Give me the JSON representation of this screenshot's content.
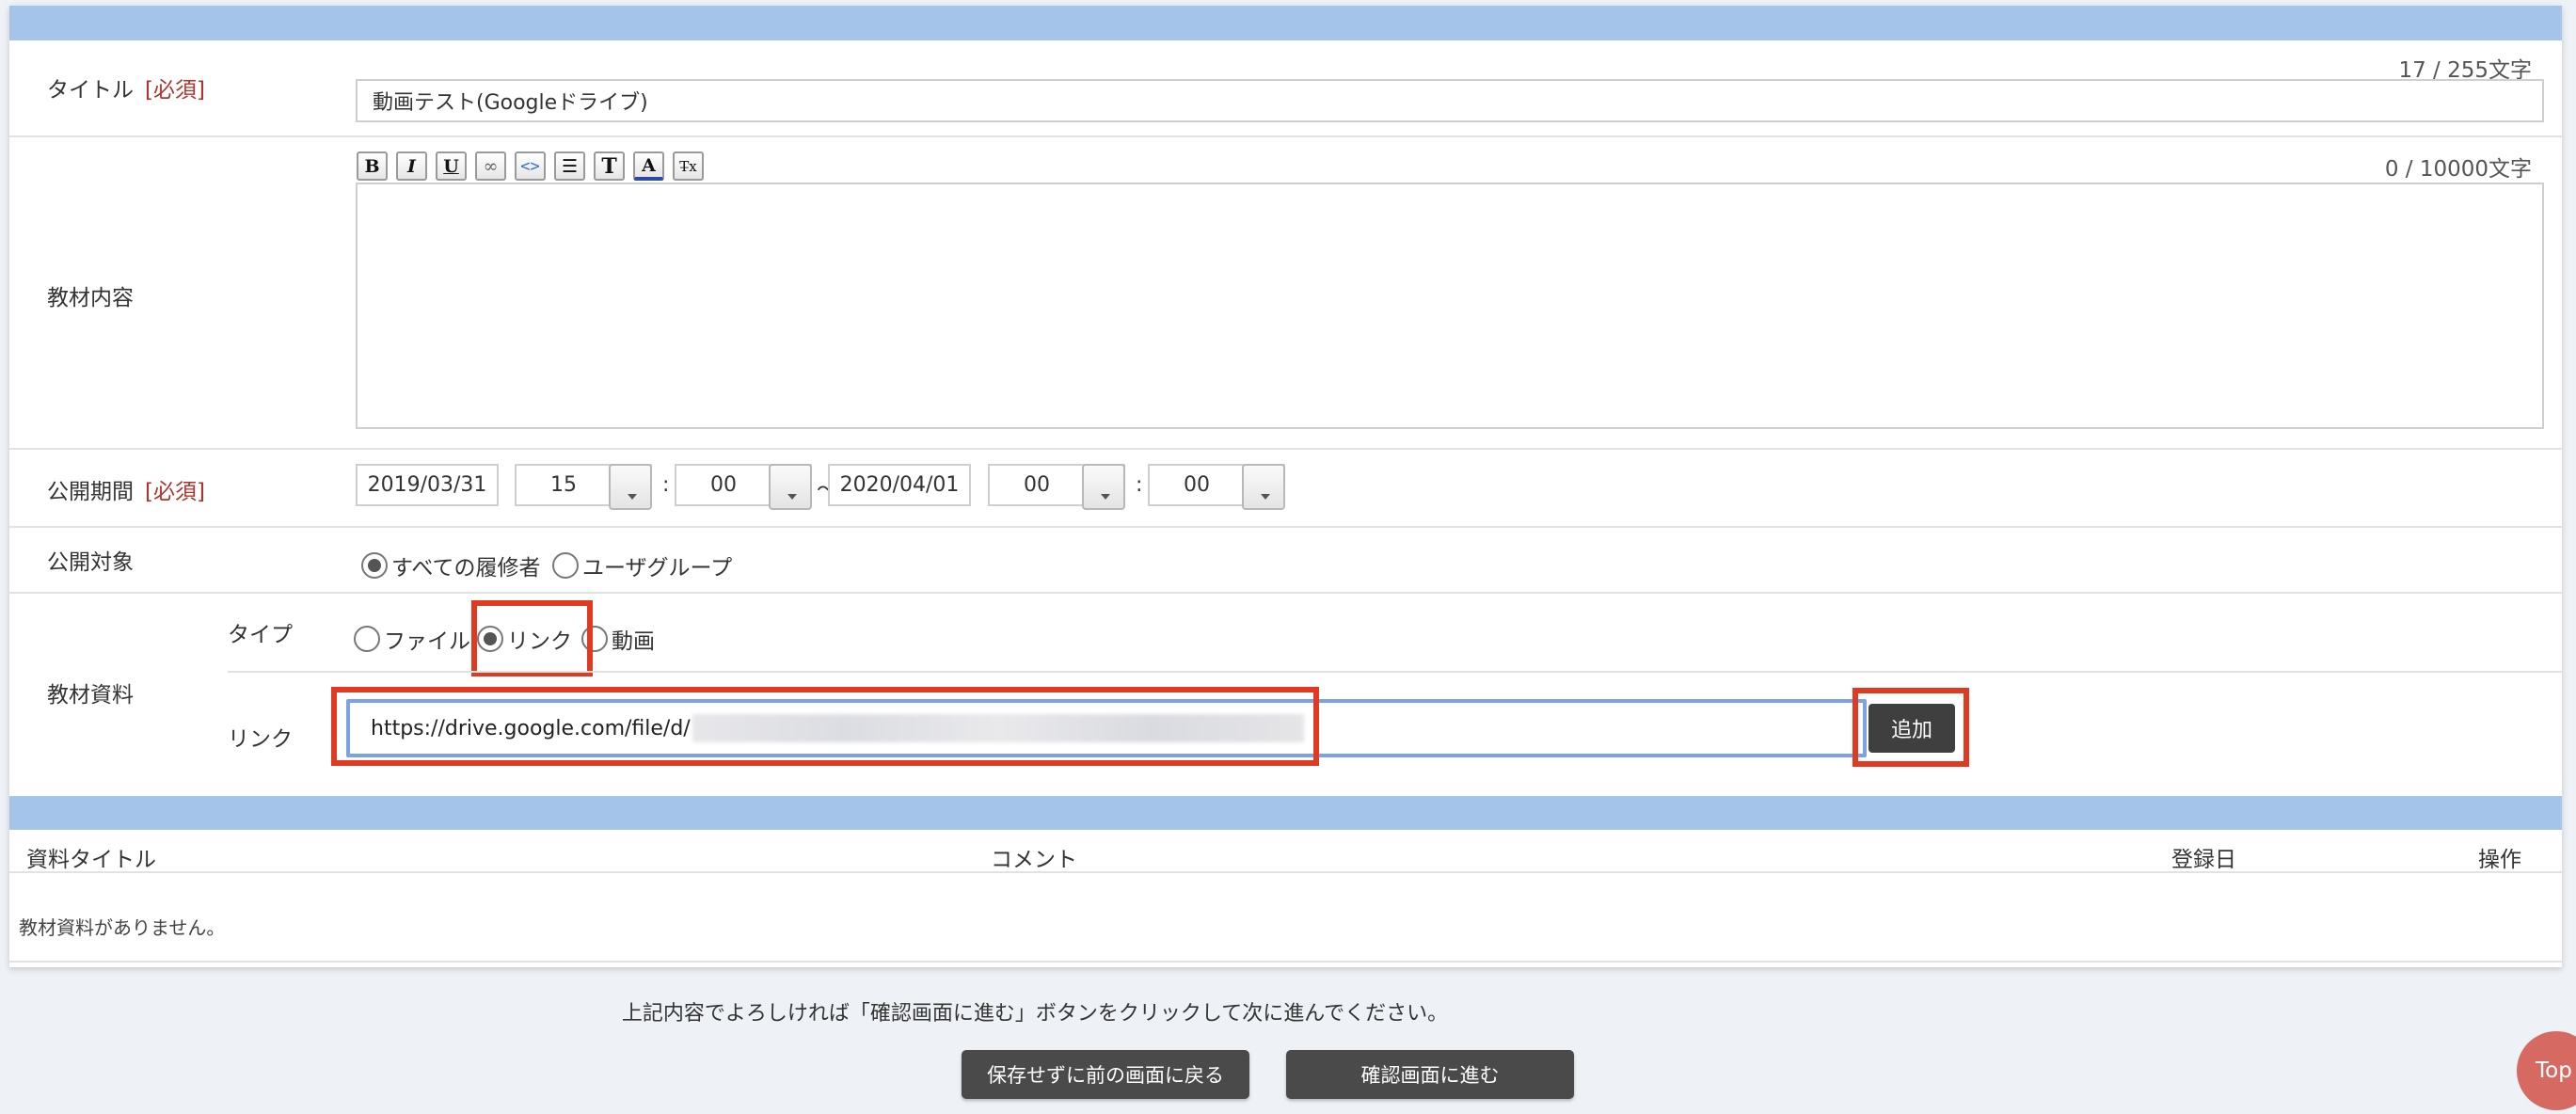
{
  "form": {
    "title": {
      "label": "タイトル",
      "required": "[必須]",
      "counter": "17 / 255文字",
      "value": "動画テスト(Googleドライブ)"
    },
    "content": {
      "label": "教材内容",
      "counter": "0 / 10000文字",
      "toolbar": [
        {
          "icon": "bold-icon",
          "glyph": "B"
        },
        {
          "icon": "italic-icon",
          "glyph": "I"
        },
        {
          "icon": "underline-icon",
          "glyph": "U"
        },
        {
          "icon": "link-icon",
          "glyph": "∞"
        },
        {
          "icon": "code-icon",
          "glyph": "<>"
        },
        {
          "icon": "bullet-list-icon",
          "glyph": "☰"
        },
        {
          "icon": "font-size-icon",
          "glyph": "T"
        },
        {
          "icon": "font-color-icon",
          "glyph": "A"
        },
        {
          "icon": "clear-format-icon",
          "glyph": "T̶x"
        }
      ]
    },
    "period": {
      "label": "公開期間",
      "required": "[必須]",
      "start_date": "2019/03/31",
      "start_hour": "15",
      "start_minute": "00",
      "tilde": "〜",
      "end_date": "2020/04/01",
      "end_hour": "00",
      "end_minute": "00",
      "colon": ":"
    },
    "audience": {
      "label": "公開対象",
      "options": [
        "すべての履修者",
        "ユーザグループ"
      ],
      "selected": "すべての履修者"
    },
    "material": {
      "label": "教材資料",
      "type_label": "タイプ",
      "type_options": [
        "ファイル",
        "リンク",
        "動画"
      ],
      "type_selected": "リンク",
      "link_label": "リンク",
      "link_value": "https://drive.google.com/file/d/",
      "add_button": "追加"
    }
  },
  "table": {
    "headers": [
      "資料タイトル",
      "コメント",
      "登録日",
      "操作"
    ],
    "empty_message": "教材資料がありません。"
  },
  "footer": {
    "note": "上記内容でよろしければ「確認画面に進む」ボタンをクリックして次に進んでください。",
    "back_button": "保存せずに前の画面に戻る",
    "confirm_button": "確認画面に進む",
    "top_button": "Top"
  },
  "colors": {
    "header_bar": "#a5c4e9",
    "required": "#b0322c",
    "highlight": "#e03a22",
    "button": "#4a4a4a",
    "top_button": "#d66a63"
  }
}
